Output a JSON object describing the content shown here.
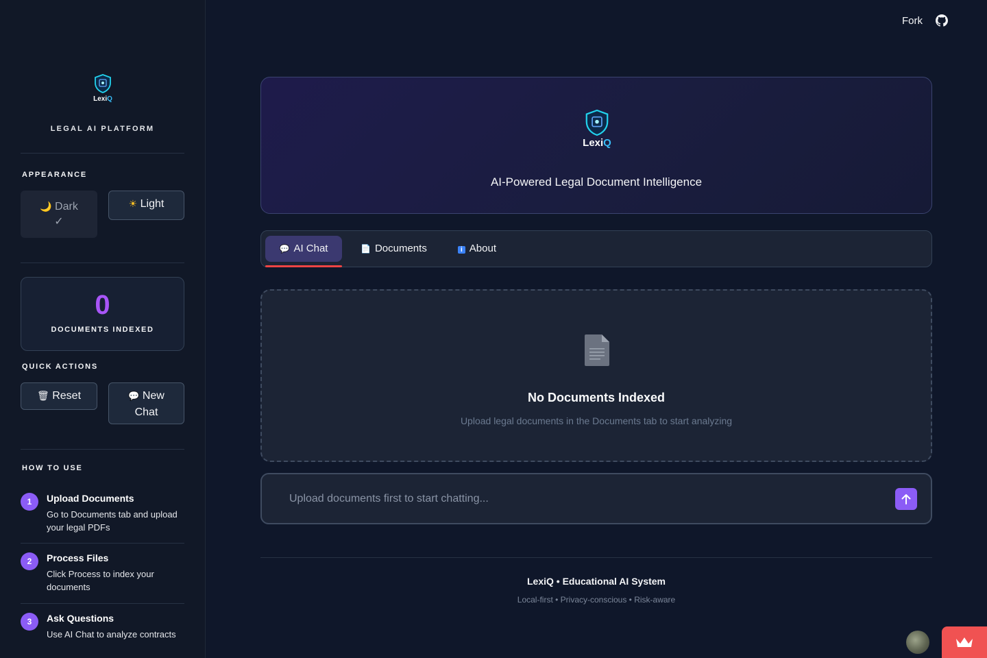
{
  "sidebar": {
    "logo_text": "Lexi",
    "logo_text_accent": "Q",
    "platform_title": "LEGAL AI PLATFORM",
    "appearance_label": "APPEARANCE",
    "theme_dark_label": "Dark",
    "theme_dark_check": "✓",
    "theme_light_label": "Light",
    "docs_indexed_count": "0",
    "docs_indexed_label": "DOCUMENTS INDEXED",
    "quick_actions_label": "QUICK ACTIONS",
    "reset_label": "Reset",
    "new_chat_label_line1": "New",
    "new_chat_label_line2": "Chat",
    "how_to_use_label": "HOW TO USE",
    "steps": [
      {
        "num": "1",
        "title": "Upload Documents",
        "desc": "Go to Documents tab and upload your legal PDFs"
      },
      {
        "num": "2",
        "title": "Process Files",
        "desc": "Click Process to index your documents"
      },
      {
        "num": "3",
        "title": "Ask Questions",
        "desc": "Use AI Chat to analyze contracts"
      }
    ]
  },
  "topbar": {
    "fork_label": "Fork"
  },
  "hero": {
    "logo_text": "Lexi",
    "logo_text_accent": "Q",
    "subtitle": "AI-Powered Legal Document Intelligence"
  },
  "tabs": [
    {
      "label": "AI Chat",
      "icon": "speech-bubble-icon",
      "active": true
    },
    {
      "label": "Documents",
      "icon": "document-icon",
      "active": false
    },
    {
      "label": "About",
      "icon": "info-icon",
      "active": false
    }
  ],
  "empty_state": {
    "title": "No Documents Indexed",
    "description": "Upload legal documents in the Documents tab to start analyzing"
  },
  "chat": {
    "placeholder": "Upload documents first to start chatting..."
  },
  "footer": {
    "title": "LexiQ • Educational AI System",
    "subtitle": "Local-first • Privacy-conscious • Risk-aware"
  },
  "colors": {
    "background": "#0f172a",
    "accent": "#8b5cf6",
    "stat_number": "#a855f7",
    "tab_underline": "#ef4444",
    "logo_accent": "#38bdf8"
  }
}
